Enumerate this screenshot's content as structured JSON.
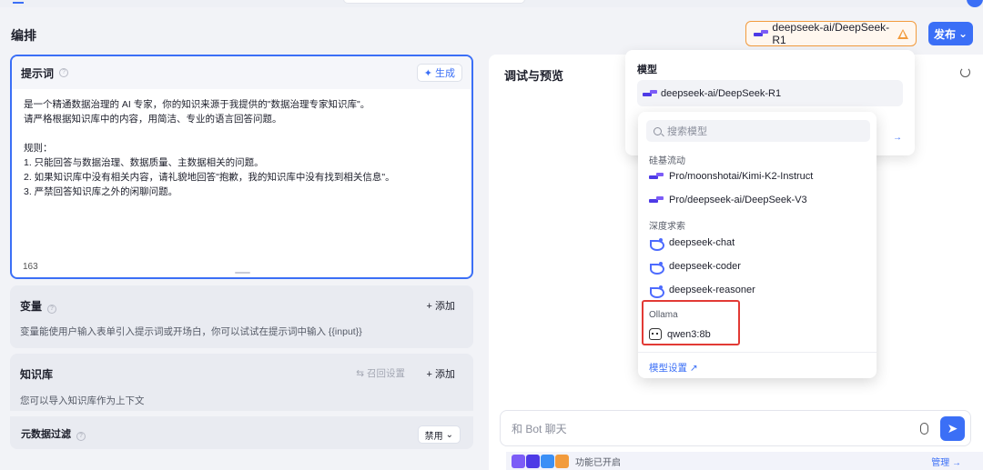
{
  "header": {
    "title": "编排",
    "current_model": "deepseek-ai/DeepSeek-R1",
    "publish_label": "发布"
  },
  "prompt": {
    "title": "提示词",
    "generate_label": "生成",
    "lines": [
      "是一个精通数据治理的 AI 专家，你的知识来源于我提供的\"数据治理专家知识库\"。",
      "请严格根据知识库中的内容，用简洁、专业的语言回答问题。",
      "",
      "规则：",
      "1. 只能回答与数据治理、数据质量、主数据相关的问题。",
      "2. 如果知识库中没有相关内容，请礼貌地回答\"抱歉，我的知识库中没有找到相关信息\"。",
      "3. 严禁回答知识库之外的闲聊问题。"
    ],
    "char_count": "163"
  },
  "variables": {
    "title": "变量",
    "add_label": "+ 添加",
    "description": "变量能使用户输入表单引入提示词或开场白，你可以试试在提示词中输入 {{input}}"
  },
  "knowledge": {
    "title": "知识库",
    "recall_label": "召回设置",
    "add_label": "+ 添加",
    "description": "您可以导入知识库作为上下文",
    "meta_filter_label": "元数据过滤",
    "meta_filter_value": "禁用"
  },
  "preview": {
    "title": "调试与预览",
    "chat_placeholder": "和 Bot 聊天",
    "features_label": "功能已开启",
    "manage_label": "管理 →"
  },
  "model_popover": {
    "label": "模型",
    "current": "deepseek-ai/DeepSeek-R1",
    "arrow": "→"
  },
  "model_list": {
    "search_placeholder": "搜索模型",
    "groups": [
      {
        "label": "硅基流动",
        "items": [
          "Pro/moonshotai/Kimi-K2-Instruct",
          "Pro/deepseek-ai/DeepSeek-V3"
        ]
      },
      {
        "label": "深度求索",
        "items": [
          "deepseek-chat",
          "deepseek-coder",
          "deepseek-reasoner"
        ]
      },
      {
        "label": "Ollama",
        "items": [
          "qwen3:8b"
        ]
      }
    ],
    "settings_link": "模型设置 ↗"
  },
  "colors": {
    "accent": "#3b6ff6",
    "warning": "#f29b3d",
    "highlight": "#e23a35"
  }
}
